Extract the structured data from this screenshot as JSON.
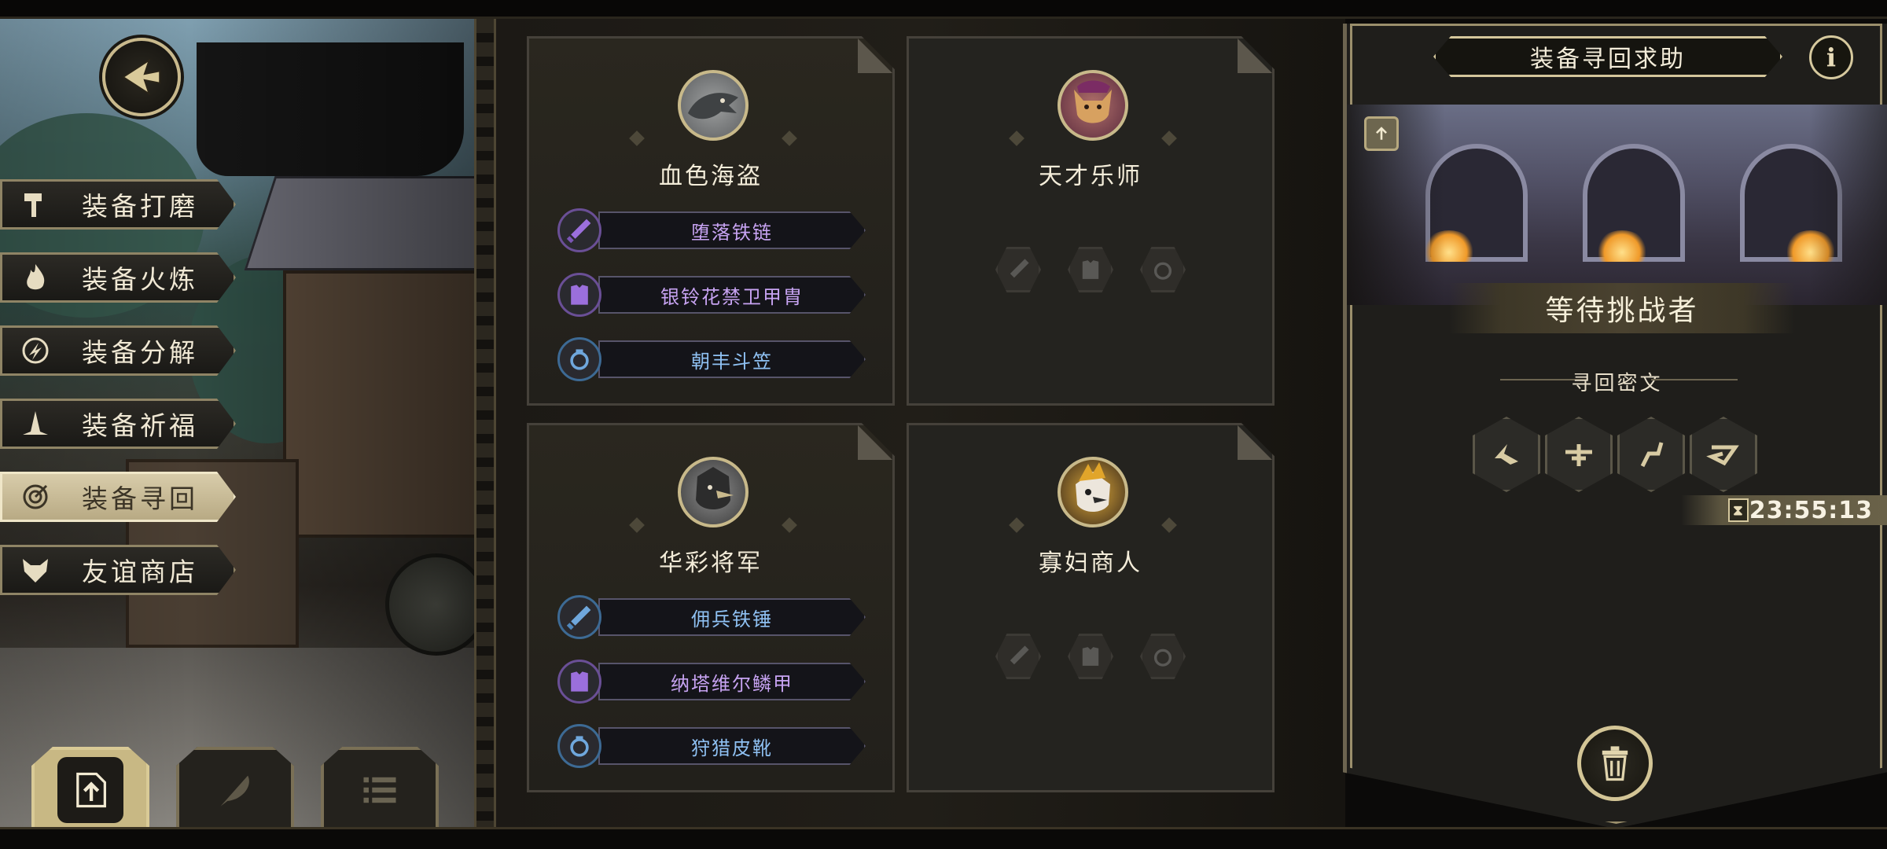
{
  "menu": {
    "items": [
      {
        "label": "装备打磨",
        "icon": "hammer-icon",
        "active": false
      },
      {
        "label": "装备火炼",
        "icon": "flame-icon",
        "active": false
      },
      {
        "label": "装备分解",
        "icon": "dismantle-icon",
        "active": false
      },
      {
        "label": "装备祈福",
        "icon": "pray-icon",
        "active": false
      },
      {
        "label": "装备寻回",
        "icon": "retrieve-icon",
        "active": true
      },
      {
        "label": "友谊商店",
        "icon": "fox-icon",
        "active": false
      }
    ],
    "bottom_buttons": [
      {
        "icon": "upload-icon",
        "active": true
      },
      {
        "icon": "feather-icon",
        "active": false
      },
      {
        "icon": "list-icon",
        "active": false
      }
    ]
  },
  "cards": [
    {
      "name": "血色海盗",
      "portrait_icon": "shark-portrait-icon",
      "slots": [
        {
          "type": "weapon",
          "icon": "sword-icon",
          "label": "堕落铁链",
          "quality_color": "#c7a3f2"
        },
        {
          "type": "armor",
          "icon": "armor-icon",
          "label": "银铃花禁卫甲胄",
          "quality_color": "#c7a3f2"
        },
        {
          "type": "accessory",
          "icon": "ring-icon",
          "label": "朝丰斗笠",
          "quality_color": "#8fc1f3"
        }
      ]
    },
    {
      "name": "天才乐师",
      "portrait_icon": "dog-portrait-icon",
      "slots": []
    },
    {
      "name": "华彩将军",
      "portrait_icon": "bird-portrait-icon",
      "slots": [
        {
          "type": "weapon",
          "icon": "sword-icon",
          "label": "佣兵铁锤",
          "quality_color": "#8fc1f3"
        },
        {
          "type": "armor",
          "icon": "armor-icon",
          "label": "纳塔维尔鳞甲",
          "quality_color": "#c7a3f2"
        },
        {
          "type": "accessory",
          "icon": "ring-icon",
          "label": "狩猎皮靴",
          "quality_color": "#8fc1f3"
        }
      ]
    },
    {
      "name": "寡妇商人",
      "portrait_icon": "bird-portrait-icon",
      "slots": []
    }
  ],
  "panel": {
    "title": "装备寻回求助",
    "info_label": "i",
    "status": "等待挑战者",
    "clue_title": "寻回密文",
    "runes": [
      "rune-1-icon",
      "rune-2-icon",
      "rune-3-icon",
      "rune-4-icon"
    ],
    "timer": "23:55:13",
    "timer_icon": "hourglass-icon",
    "trash_icon": "trash-icon"
  },
  "colors": {
    "accent": "#c9b98c",
    "epic": "#c7a3f2",
    "rare": "#8fc1f3"
  }
}
